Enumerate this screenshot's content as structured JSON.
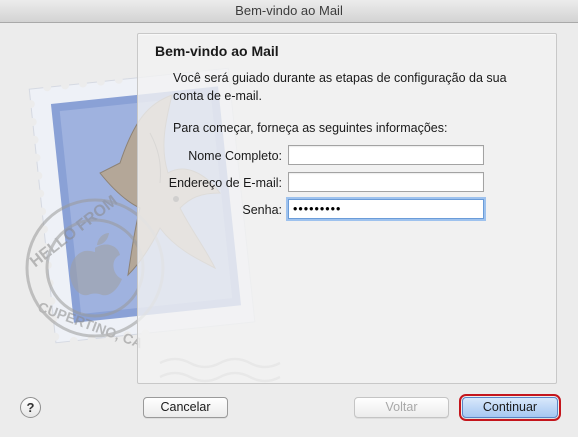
{
  "window": {
    "title": "Bem-vindo ao Mail"
  },
  "panel": {
    "title": "Bem-vindo ao Mail",
    "intro": "Você será guiado durante as etapas de configuração da sua conta de e-mail.",
    "instructions": "Para começar, forneça as seguintes informações:"
  },
  "form": {
    "full_name_label": "Nome Completo:",
    "full_name_value": "",
    "email_label": "Endereço de E-mail:",
    "email_value": "",
    "password_label": "Senha:",
    "password_value": "•••••••••"
  },
  "buttons": {
    "help": "?",
    "cancel": "Cancelar",
    "back": "Voltar",
    "continue": "Continuar"
  },
  "stamp": {
    "text_top": "HELLO FROM",
    "text_bottom": "CUPERTINO, CA"
  }
}
